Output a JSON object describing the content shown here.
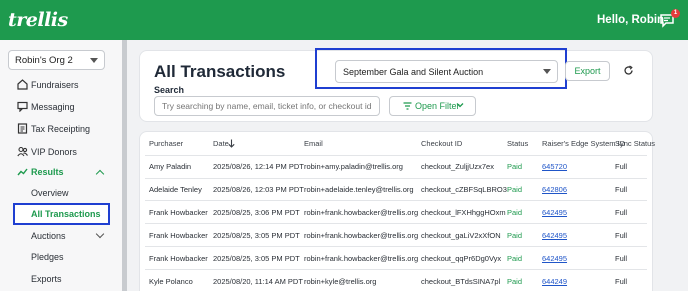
{
  "header": {
    "logo": "trellis",
    "greeting": "Hello, Robin",
    "notification_count": "1"
  },
  "sidebar": {
    "org_select": "Robin's Org 2",
    "items": [
      {
        "label": "Fundraisers",
        "icon": "home-icon"
      },
      {
        "label": "Messaging",
        "icon": "chat-icon"
      },
      {
        "label": "Tax Receipting",
        "icon": "receipt-icon"
      },
      {
        "label": "VIP Donors",
        "icon": "users-icon"
      },
      {
        "label": "Results",
        "icon": "chart-trend-icon"
      }
    ],
    "sub_items": [
      {
        "label": "Overview"
      },
      {
        "label": "All Transactions"
      },
      {
        "label": "Auctions"
      },
      {
        "label": "Pledges"
      },
      {
        "label": "Exports"
      }
    ]
  },
  "main": {
    "title": "All Transactions",
    "event_select": "September Gala and Silent Auction",
    "export_label": "Export",
    "search_label": "Search",
    "search_placeholder": "Try searching by name, email, ticket info, or checkout id",
    "filter_label": "Open Filter"
  },
  "table": {
    "columns": [
      "Purchaser",
      "Date",
      "Email",
      "Checkout ID",
      "Status",
      "Raiser's Edge System ID",
      "Sync Status"
    ],
    "rows": [
      {
        "purchaser": "Amy Paladin",
        "date": "2025/08/26, 12:14 PM PDT",
        "email": "robin+amy.paladin@trellis.org",
        "checkout": "checkout_ZuljjUzx7ex",
        "status": "Paid",
        "re_id": "645720",
        "sync": "Full"
      },
      {
        "purchaser": "Adelaide Tenley",
        "date": "2025/08/26, 12:03 PM PDT",
        "email": "robin+adelaide.tenley@trellis.org",
        "checkout": "checkout_cZBFSqLBRO3",
        "status": "Paid",
        "re_id": "642806",
        "sync": "Full"
      },
      {
        "purchaser": "Frank Howbacker",
        "date": "2025/08/25, 3:06 PM PDT",
        "email": "robin+frank.howbacker@trellis.org",
        "checkout": "checkout_lFXHhggHOxm",
        "status": "Paid",
        "re_id": "642495",
        "sync": "Full"
      },
      {
        "purchaser": "Frank Howbacker",
        "date": "2025/08/25, 3:05 PM PDT",
        "email": "robin+frank.howbacker@trellis.org",
        "checkout": "checkout_gaLiV2xXfON",
        "status": "Paid",
        "re_id": "642495",
        "sync": "Full"
      },
      {
        "purchaser": "Frank Howbacker",
        "date": "2025/08/25, 3:05 PM PDT",
        "email": "robin+frank.howbacker@trellis.org",
        "checkout": "checkout_qqPr6Dg0Vyx",
        "status": "Paid",
        "re_id": "642495",
        "sync": "Full"
      },
      {
        "purchaser": "Kyle Polanco",
        "date": "2025/08/20, 11:14 AM PDT",
        "email": "robin+kyle@trellis.org",
        "checkout": "checkout_BTdsSINA7pl",
        "status": "Paid",
        "re_id": "644249",
        "sync": "Full"
      }
    ]
  },
  "colors": {
    "brand_green": "#1e9a4e",
    "highlight_blue": "#1f3fd1",
    "link_blue": "#1f55c8"
  }
}
